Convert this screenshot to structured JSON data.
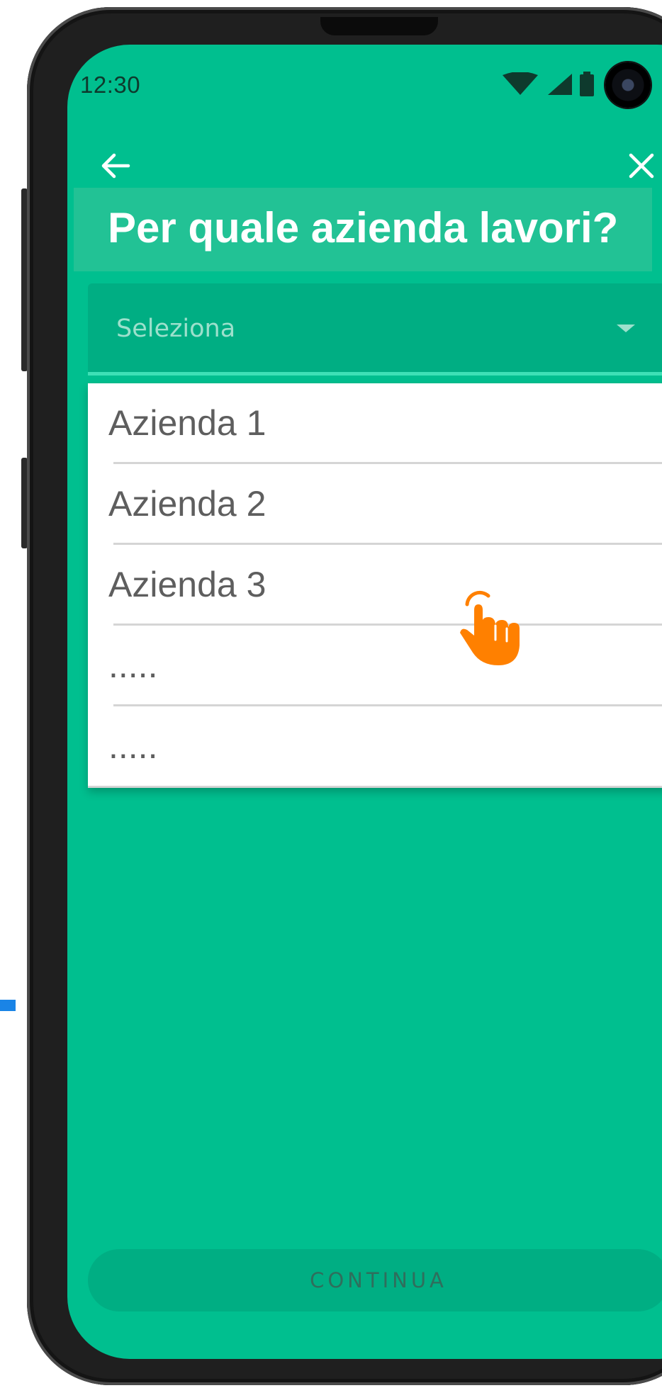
{
  "status_bar": {
    "time": "12:30",
    "icons": [
      "wifi-icon",
      "cellular-signal-icon",
      "battery-icon"
    ]
  },
  "header": {
    "back_icon": "arrow-left-icon",
    "close_icon": "close-icon",
    "title": "Per quale azienda lavori?"
  },
  "select": {
    "placeholder": "Seleziona",
    "caret_icon": "chevron-down-icon"
  },
  "dropdown": {
    "options": [
      "Azienda 1",
      "Azienda 2",
      "Azienda 3",
      ".....",
      "....."
    ]
  },
  "pointer": {
    "icon": "tap-hand-icon",
    "color": "#ff8000"
  },
  "footer": {
    "continue_label": "CONTINUA"
  },
  "colors": {
    "background": "#00bf8f",
    "field": "#00ae83",
    "accent_underline": "#3ee0b6"
  }
}
